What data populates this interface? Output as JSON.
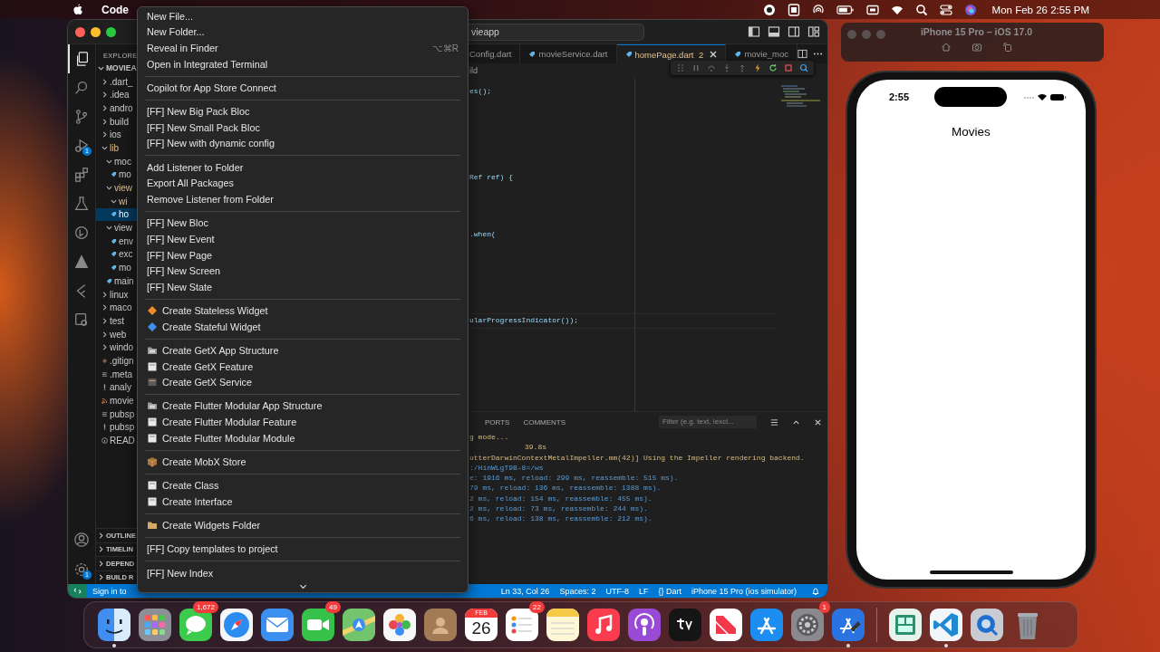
{
  "menubar": {
    "app": "Code",
    "clock": "Mon Feb 26  2:55 PM"
  },
  "vscode": {
    "search": "vieapp",
    "activity_top": [
      {
        "kind": "files",
        "selected": true
      },
      {
        "kind": "search",
        "selected": false
      },
      {
        "kind": "source-control",
        "selected": false
      },
      {
        "kind": "run-debug",
        "selected": false,
        "badge": "1"
      },
      {
        "kind": "extensions",
        "selected": false
      },
      {
        "kind": "testing",
        "selected": false
      },
      {
        "kind": "git-graph",
        "selected": false
      },
      {
        "kind": "triangle",
        "selected": false
      },
      {
        "kind": "flutter",
        "selected": false
      },
      {
        "kind": "remote",
        "selected": false
      }
    ],
    "activity_bottom": [
      {
        "kind": "account"
      },
      {
        "kind": "settings",
        "badge": "1"
      }
    ],
    "explorer": {
      "title": "EXPLORE",
      "root": "MOVIEA",
      "tree": [
        {
          "label": ".dart_",
          "kind": "folder",
          "expanded": false,
          "selected": false,
          "modified": false
        },
        {
          "label": ".idea",
          "kind": "folder",
          "expanded": false,
          "selected": false,
          "modified": false
        },
        {
          "label": "andro",
          "kind": "folder",
          "expanded": false,
          "selected": false,
          "modified": false
        },
        {
          "label": "build",
          "kind": "folder",
          "expanded": false,
          "selected": false,
          "modified": false
        },
        {
          "label": "ios",
          "kind": "folder",
          "expanded": false,
          "selected": false,
          "modified": false
        },
        {
          "label": "lib",
          "kind": "folder",
          "expanded": true,
          "selected": false,
          "modified": true,
          "children": [
            {
              "label": "moc",
              "kind": "folder",
              "expanded": true,
              "selected": false,
              "modified": false,
              "children": [
                {
                  "label": "mo",
                  "kind": "dart",
                  "selected": false,
                  "modified": false
                }
              ]
            },
            {
              "label": "view",
              "kind": "folder",
              "expanded": true,
              "selected": false,
              "modified": true,
              "children": [
                {
                  "label": "wi",
                  "kind": "folder",
                  "expanded": true,
                  "selected": false,
                  "modified": true
                },
                {
                  "label": "ho",
                  "kind": "dart",
                  "selected": true,
                  "modified": false
                }
              ]
            },
            {
              "label": "view",
              "kind": "folder",
              "expanded": true,
              "selected": false,
              "modified": false,
              "children": [
                {
                  "label": "env",
                  "kind": "dart",
                  "selected": false,
                  "modified": false
                },
                {
                  "label": "exc",
                  "kind": "dart",
                  "selected": false,
                  "modified": false
                },
                {
                  "label": "mo",
                  "kind": "dart",
                  "selected": false,
                  "modified": false
                }
              ]
            },
            {
              "label": "main",
              "kind": "dart",
              "selected": false,
              "modified": false
            }
          ]
        },
        {
          "label": "linux",
          "kind": "folder",
          "expanded": false,
          "selected": false,
          "modified": false
        },
        {
          "label": "maco",
          "kind": "folder",
          "expanded": false,
          "selected": false,
          "modified": false
        },
        {
          "label": "test",
          "kind": "folder",
          "expanded": false,
          "selected": false,
          "modified": false
        },
        {
          "label": "web",
          "kind": "folder",
          "expanded": false,
          "selected": false,
          "modified": false
        },
        {
          "label": "windo",
          "kind": "folder",
          "expanded": false,
          "selected": false,
          "modified": false
        },
        {
          "label": ".gitign",
          "kind": "git",
          "selected": false,
          "modified": false
        },
        {
          "label": ".meta",
          "kind": "lines",
          "selected": false,
          "modified": false
        },
        {
          "label": "analy",
          "kind": "bang",
          "selected": false,
          "modified": false
        },
        {
          "label": "movie",
          "kind": "rss",
          "selected": false,
          "modified": false
        },
        {
          "label": "pubsp",
          "kind": "lines",
          "selected": false,
          "modified": false
        },
        {
          "label": "pubsp",
          "kind": "bang",
          "selected": false,
          "modified": false
        },
        {
          "label": "READ",
          "kind": "info",
          "selected": false,
          "modified": false
        }
      ]
    },
    "sections": [
      "OUTLINE",
      "TIMELIN",
      "DEPEND",
      "BUILD R"
    ],
    "tabs": [
      {
        "label": "Config.dart",
        "selected": false,
        "kind": "plain"
      },
      {
        "label": "movieService.dart",
        "selected": false,
        "kind": "dart"
      },
      {
        "label": "homePage.dart",
        "problems": "2",
        "selected": true,
        "kind": "dart"
      },
      {
        "label": "movie_moc",
        "selected": false,
        "kind": "dart"
      }
    ],
    "breadcrumb": "ild",
    "code": [
      {
        "text": "es();"
      },
      {
        "text": "Ref ref) {"
      },
      {
        "text": ".when("
      },
      {
        "text": "ularProgressIndicator());"
      }
    ],
    "panel": {
      "tabs": [
        "PORTS",
        "COMMENTS"
      ],
      "filter_placeholder": "Filter (e.g. text, !excl...",
      "lines": [
        {
          "text": "g mode...",
          "kind": "notice"
        },
        {
          "text": "39.8s",
          "kind": "timing"
        },
        {
          "text": "utterDarwinContextMetalImpeller.mm(42)] Using the Impeller rendering backend.",
          "kind": "notice"
        },
        {
          "text": ":/HinWLgT9B-8=/ws",
          "kind": "info"
        },
        {
          "text": "e: 1916 ms, reload: 299 ms, reassemble: 515 ms).",
          "kind": "info"
        },
        {
          "text": "79 ms, reload: 136 ms, reassemble: 1388 ms).",
          "kind": "info"
        },
        {
          "text": "2 ms, reload: 154 ms, reassemble: 455 ms).",
          "kind": "info"
        },
        {
          "text": "2 ms, reload: 73 ms, reassemble: 244 ms).",
          "kind": "info"
        },
        {
          "text": "6 ms, reload: 138 ms, reassemble: 212 ms).",
          "kind": "info"
        }
      ]
    },
    "status": {
      "left": "Sign in to",
      "right": [
        "Ln 33, Col 26",
        "Spaces: 2",
        "UTF-8",
        "LF",
        "{} Dart",
        "iPhone 15 Pro (ios simulator)"
      ]
    }
  },
  "context_menu": [
    {
      "items": [
        {
          "label": "New File..."
        },
        {
          "label": "New Folder..."
        },
        {
          "label": "Reveal in Finder",
          "shortcut": "⌥⌘R"
        },
        {
          "label": "Open in Integrated Terminal"
        }
      ]
    },
    {
      "items": [
        {
          "label": "Copilot for App Store Connect"
        }
      ]
    },
    {
      "items": [
        {
          "label": "[FF] New Big Pack Bloc"
        },
        {
          "label": "[FF] New Small Pack Bloc"
        },
        {
          "label": "[FF] New with dynamic config"
        }
      ]
    },
    {
      "items": [
        {
          "label": "Add Listener to Folder"
        },
        {
          "label": "Export All Packages"
        },
        {
          "label": "Remove Listener from Folder"
        }
      ]
    },
    {
      "items": [
        {
          "label": "[FF] New Bloc"
        },
        {
          "label": "[FF] New Event"
        },
        {
          "label": "[FF] New Page"
        },
        {
          "label": "[FF] New Screen"
        },
        {
          "label": "[FF] New State"
        }
      ]
    },
    {
      "items": [
        {
          "label": "Create Stateless Widget",
          "kind": "diamond",
          "color": "#f08c2a"
        },
        {
          "label": "Create Stateful Widget",
          "kind": "diamond",
          "color": "#3d8ff0"
        }
      ]
    },
    {
      "items": [
        {
          "label": "Create GetX App Structure",
          "kind": "folder"
        },
        {
          "label": "Create GetX Feature",
          "kind": "page"
        },
        {
          "label": "Create GetX Service",
          "kind": "service"
        }
      ]
    },
    {
      "items": [
        {
          "label": "Create Flutter Modular App Structure",
          "kind": "folder"
        },
        {
          "label": "Create Flutter Modular Feature",
          "kind": "page"
        },
        {
          "label": "Create Flutter Modular Module",
          "kind": "page"
        }
      ]
    },
    {
      "items": [
        {
          "label": "Create MobX Store",
          "kind": "box"
        }
      ]
    },
    {
      "items": [
        {
          "label": "Create Class",
          "kind": "page"
        },
        {
          "label": "Create Interface",
          "kind": "page"
        }
      ]
    },
    {
      "items": [
        {
          "label": "Create Widgets Folder",
          "kind": "tan-folder"
        }
      ]
    },
    {
      "items": [
        {
          "label": "[FF] Copy templates to project"
        }
      ]
    },
    {
      "items": [
        {
          "label": "[FF] New Index"
        }
      ]
    }
  ],
  "simulator": {
    "title": "iPhone 15 Pro – iOS 17.0",
    "time": "2:55",
    "screen_title": "Movies"
  },
  "dock": [
    {
      "kind": "finder",
      "running": true
    },
    {
      "kind": "launchpad",
      "running": false
    },
    {
      "kind": "messages",
      "running": false,
      "badge": "1,672"
    },
    {
      "kind": "safari",
      "running": false
    },
    {
      "kind": "mail",
      "running": false
    },
    {
      "kind": "facetime",
      "running": false,
      "badge": "49"
    },
    {
      "kind": "maps",
      "running": false
    },
    {
      "kind": "photos",
      "running": false
    },
    {
      "kind": "contacts",
      "running": false
    },
    {
      "kind": "calendar",
      "running": false,
      "month": "FEB",
      "day": "26"
    },
    {
      "kind": "reminders",
      "running": false,
      "badge": "22"
    },
    {
      "kind": "notes",
      "running": false
    },
    {
      "kind": "music",
      "running": false
    },
    {
      "kind": "podcasts",
      "running": false
    },
    {
      "kind": "tv",
      "running": false
    },
    {
      "kind": "news",
      "running": false
    },
    {
      "kind": "appstore",
      "running": false
    },
    {
      "kind": "settings",
      "running": false,
      "badge": "1"
    },
    {
      "kind": "xcode",
      "running": true
    },
    {
      "kind": "divider"
    },
    {
      "kind": "window-app",
      "running": false
    },
    {
      "kind": "vscode",
      "running": true
    },
    {
      "kind": "quicktime",
      "running": false
    },
    {
      "kind": "trash",
      "running": false
    }
  ]
}
